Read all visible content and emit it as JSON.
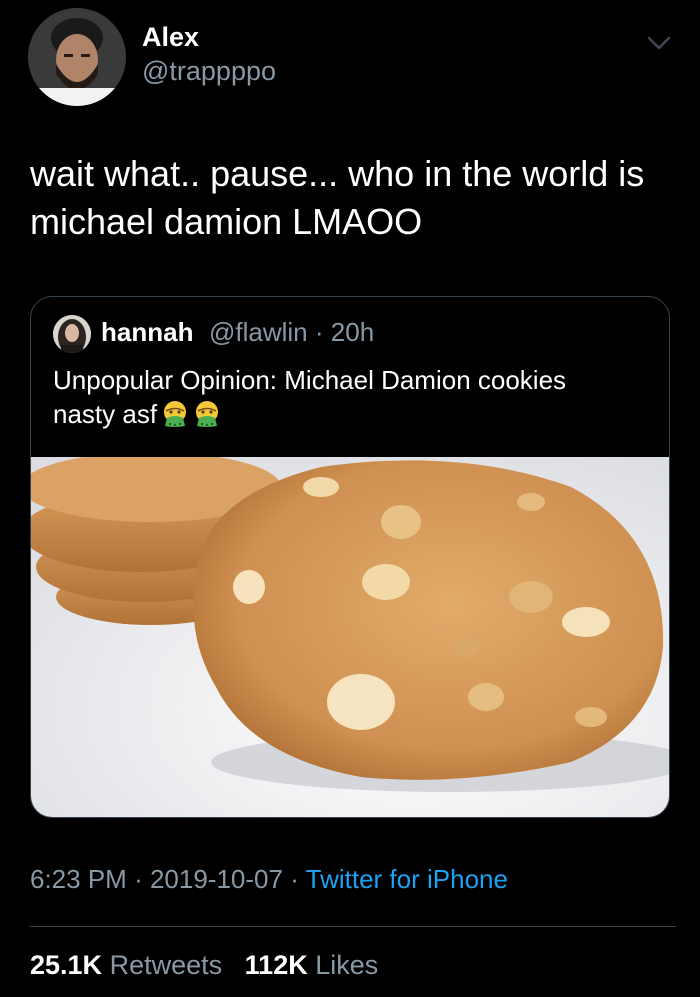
{
  "tweet": {
    "author": {
      "name": "Alex",
      "handle": "@trappppo",
      "avatar_icon": "user-avatar"
    },
    "text_line1": "wait what.. pause... who in the world is",
    "text_line2": "michael damion LMAOO",
    "menu_icon": "chevron-down-icon",
    "quoted": {
      "name": "hannah",
      "handle": "@flawlin",
      "separator": "·",
      "time": "20h",
      "text_line1": "Unpopular Opinion: Michael Damion cookies",
      "text_line2": "nasty asf",
      "emoji_icon": "nauseated-face-emoji",
      "image_subject": "cookies-photo"
    },
    "meta": {
      "time": "6:23 PM",
      "dot1": "·",
      "date": "2019-10-07",
      "dot2": "·",
      "source": "Twitter for iPhone"
    },
    "stats": {
      "retweets_count": "25.1K",
      "retweets_label": "Retweets",
      "likes_count": "112K",
      "likes_label": "Likes"
    }
  },
  "colors": {
    "background": "#000000",
    "text": "#ffffff",
    "secondary": "#8899a6",
    "link": "#1da1f2",
    "border": "#38444d"
  }
}
